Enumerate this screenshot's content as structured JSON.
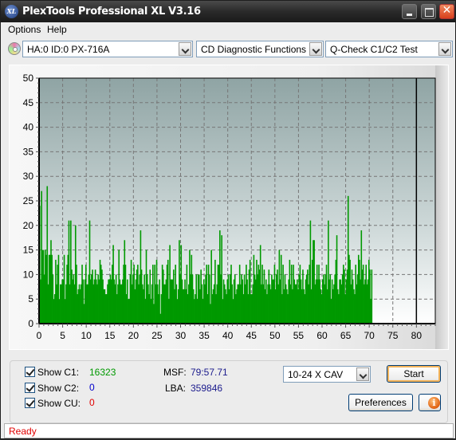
{
  "window": {
    "title": "PlexTools Professional XL V3.16",
    "logo_text": "XL"
  },
  "menu": [
    "Options",
    "Help"
  ],
  "toolbar": {
    "drive": "HA:0 ID:0  PX-716A",
    "function": "CD Diagnostic Functions",
    "test": "Q-Check C1/C2 Test"
  },
  "controls": {
    "show_c1_label": "Show C1:",
    "show_c2_label": "Show C2:",
    "show_cu_label": "Show CU:",
    "c1_value": "16323",
    "c2_value": "0",
    "cu_value": "0",
    "msf_label": "MSF:",
    "msf_value": "79:57.71",
    "lba_label": "LBA:",
    "lba_value": "359846",
    "speed": "10-24 X CAV",
    "start_label": "Start",
    "preferences_label": "Preferences"
  },
  "colors": {
    "c1": "#009900",
    "c2": "#0000cc",
    "cu": "#e00000",
    "msf": "#1a1a8c"
  },
  "status": "Ready",
  "chart_data": {
    "type": "bar",
    "title": "",
    "xlabel": "",
    "ylabel": "",
    "xlim": [
      0,
      84
    ],
    "ylim": [
      0,
      50
    ],
    "x_ticks": [
      0,
      5,
      10,
      15,
      20,
      25,
      30,
      35,
      40,
      45,
      50,
      55,
      60,
      65,
      70,
      75,
      80
    ],
    "y_ticks": [
      0,
      5,
      10,
      15,
      20,
      25,
      30,
      35,
      40,
      45,
      50
    ],
    "grid": true,
    "end_marker_x": 80,
    "series": [
      {
        "name": "C1",
        "x_step": 0.2,
        "values": [
          24,
          9,
          27,
          15,
          15,
          10,
          15,
          14,
          28,
          8,
          14,
          14,
          17,
          14,
          10,
          5,
          6,
          13,
          8,
          12,
          14,
          5,
          8,
          8,
          9,
          9,
          14,
          5,
          8,
          12,
          14,
          21,
          8,
          21,
          11,
          9,
          10,
          8,
          20,
          12,
          6,
          7,
          8,
          7,
          8,
          12,
          9,
          4,
          9,
          12,
          8,
          8,
          10,
          21,
          9,
          10,
          11,
          8,
          9,
          11,
          9,
          8,
          10,
          9,
          13,
          12,
          11,
          9,
          7,
          7,
          6,
          6,
          8,
          9,
          9,
          10,
          9,
          12,
          16,
          9,
          8,
          10,
          6,
          8,
          15,
          9,
          8,
          8,
          9,
          12,
          17,
          12,
          6,
          9,
          5,
          5,
          10,
          13,
          8,
          10,
          12,
          7,
          9,
          11,
          12,
          8,
          10,
          19,
          11,
          8,
          7,
          10,
          5,
          15,
          10,
          8,
          6,
          11,
          5,
          8,
          12,
          4,
          12,
          8,
          13,
          8,
          6,
          9,
          2,
          6,
          12,
          11,
          8,
          8,
          9,
          12,
          13,
          5,
          16,
          9,
          9,
          9,
          11,
          7,
          12,
          8,
          5,
          7,
          17,
          10,
          16,
          9,
          7,
          7,
          9,
          7,
          12,
          6,
          8,
          15,
          10,
          14,
          10,
          7,
          5,
          6,
          10,
          5,
          10,
          10,
          7,
          11,
          8,
          5,
          9,
          8,
          10,
          12,
          6,
          12,
          10,
          4,
          15,
          6,
          7,
          8,
          13,
          6,
          8,
          12,
          12,
          19,
          10,
          18,
          5,
          9,
          8,
          7,
          6,
          9,
          10,
          7,
          10,
          12,
          8,
          5,
          9,
          10,
          6,
          7,
          8,
          8,
          12,
          8,
          10,
          9,
          6,
          10,
          8,
          12,
          9,
          6,
          11,
          13,
          6,
          6,
          8,
          14,
          10,
          9,
          13,
          10,
          12,
          11,
          16,
          8,
          12,
          8,
          11,
          7,
          9,
          6,
          8,
          11,
          8,
          7,
          10,
          9,
          9,
          12,
          7,
          10,
          11,
          8,
          15,
          9,
          14,
          6,
          12,
          7,
          10,
          8,
          7,
          6,
          9,
          13,
          8,
          12,
          7,
          12,
          9,
          8,
          8,
          9,
          7,
          10,
          12,
          9,
          7,
          11,
          7,
          6,
          9,
          10,
          11,
          8,
          12,
          21,
          7,
          13,
          17,
          17,
          8,
          9,
          12,
          9,
          12,
          9,
          7,
          6,
          9,
          10,
          8,
          10,
          12,
          7,
          21,
          9,
          10,
          5,
          9,
          7,
          8,
          10,
          13,
          18,
          7,
          6,
          9,
          9,
          8,
          10,
          12,
          11,
          6,
          9,
          11,
          26,
          14,
          13,
          8,
          11,
          9,
          7,
          6,
          12,
          8,
          10,
          14,
          13,
          9,
          19,
          11,
          12,
          8,
          9,
          12,
          8,
          9,
          13,
          11,
          5,
          11
        ]
      },
      {
        "name": "C2",
        "total": 0
      },
      {
        "name": "CU",
        "total": 0
      }
    ]
  }
}
